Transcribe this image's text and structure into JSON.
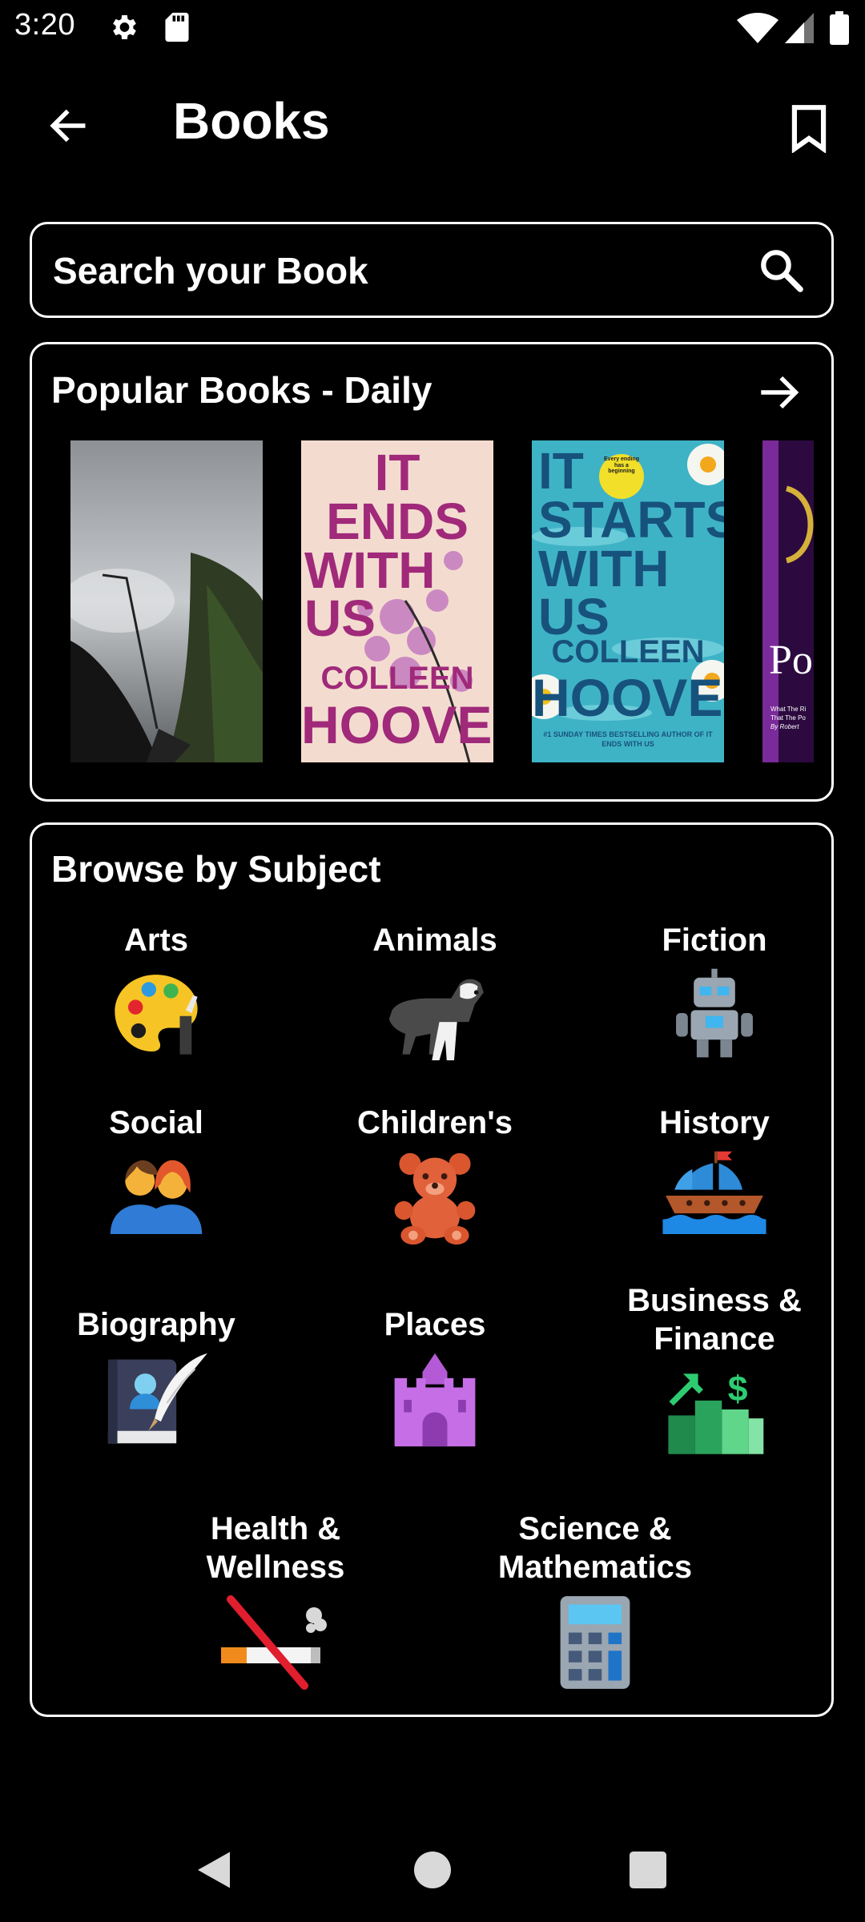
{
  "status_bar": {
    "time": "3:20"
  },
  "toolbar": {
    "title": "Books"
  },
  "search": {
    "placeholder": "Search your Book"
  },
  "popular": {
    "title": "Popular Books - Daily",
    "covers": [
      {
        "alt": "Photo cover"
      },
      {
        "title_lines": [
          "IT ENDS",
          "WITH",
          "US"
        ],
        "author_lines": [
          "COLLEEN",
          "HOOVER"
        ]
      },
      {
        "badge": "Every ending has a beginning",
        "title_lines": [
          "IT",
          "STARTS",
          "WITH US"
        ],
        "author_lines": [
          "COLLEEN",
          "HOOVER"
        ],
        "tagline": "#1 SUNDAY TIMES BESTSELLING AUTHOR OF IT ENDS WITH US"
      },
      {
        "title_fragment": "Po",
        "tagline_lines": [
          "What The Ri",
          "That The Po",
          "By Robert"
        ]
      }
    ]
  },
  "browse": {
    "title": "Browse by Subject",
    "subjects": [
      {
        "label": "Arts",
        "icon": "palette-icon"
      },
      {
        "label": "Animals",
        "icon": "dog-icon"
      },
      {
        "label": "Fiction",
        "icon": "robot-icon"
      },
      {
        "label": "Social",
        "icon": "people-icon"
      },
      {
        "label": "Children's",
        "icon": "teddy-bear-icon"
      },
      {
        "label": "History",
        "icon": "ship-icon"
      },
      {
        "label": "Biography",
        "icon": "journal-quill-icon"
      },
      {
        "label": "Places",
        "icon": "castle-icon"
      },
      {
        "label_lines": [
          "Business &",
          "Finance"
        ],
        "icon": "growth-chart-icon"
      },
      {
        "label_lines": [
          "Health &",
          "Wellness"
        ],
        "icon": "no-smoking-icon"
      },
      {
        "label_lines": [
          "Science &",
          "Mathematics"
        ],
        "icon": "calculator-icon"
      }
    ]
  }
}
